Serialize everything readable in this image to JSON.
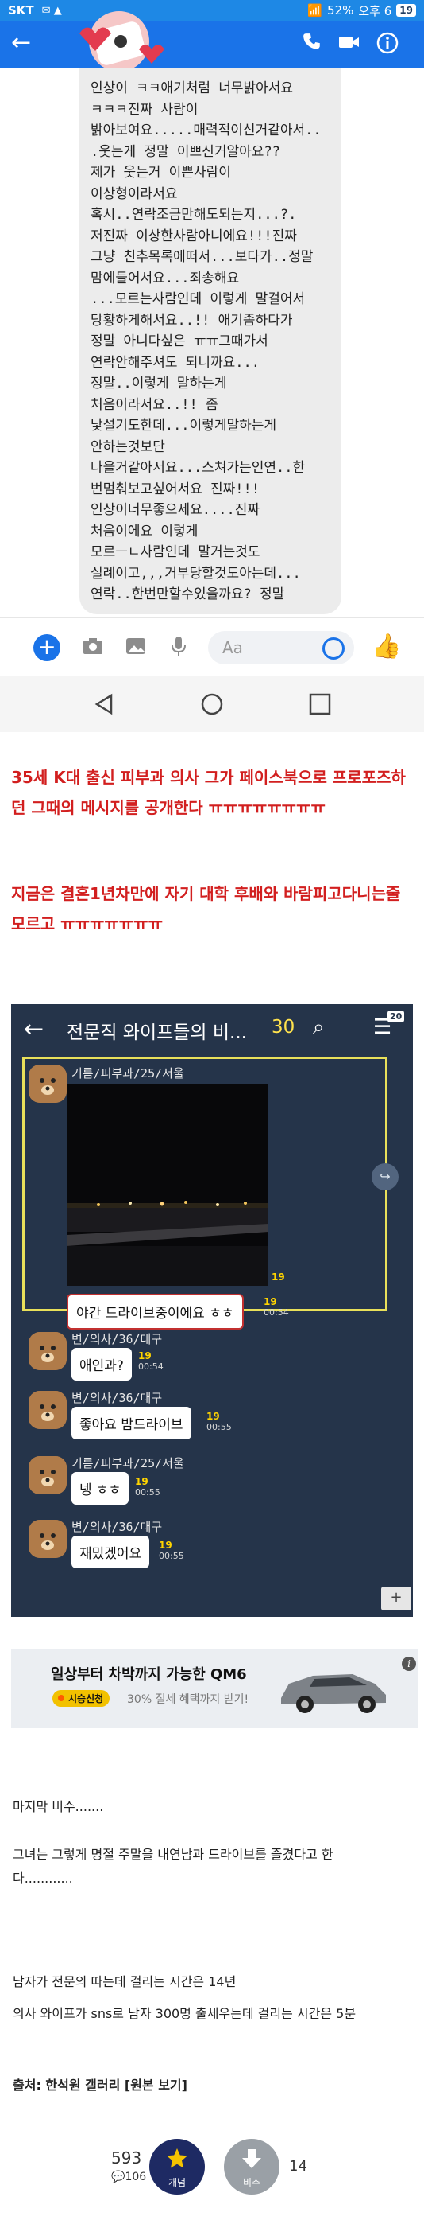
{
  "messenger": {
    "status": {
      "carrier": "SKT",
      "battery": "52%",
      "time": "오후 6",
      "badge": "19"
    },
    "chat_lines": [
      "인상이 ㅋㅋ애기처럼 너무밝아서요",
      "ㅋㅋㅋ진짜 사람이",
      "밝아보여요.....매력적이신거같아서..",
      ".웃는게 정말 이쁘신거알아요??",
      "제가 웃는거 이쁜사람이",
      "이상형이라서요",
      "혹시..연락조금만해도되는지...?.",
      "저진짜 이상한사람아니에요!!!진짜",
      "그냥 친추목록에떠서...보다가..정말",
      "맘에들어서요...죄송해요",
      "...모르는사람인데 이렇게 말걸어서",
      "당황하게해서요..!! 애기좀하다가",
      "정말 아니다싶은 ㅠㅠ그때가서",
      "연락안해주셔도 되니까요...",
      "정말..이렇게 말하는게",
      "처음이라서요..!! 좀",
      "낯설기도한데...이렇게말하는게",
      "안하는것보단",
      "나을거같아서요...스쳐가는인연..한",
      "번멈춰보고싶어서요 진짜!!!",
      "인상이너무좋으세요....진짜",
      "처음이에요 이렇게",
      "모르ㅡㄴ사람인데 말거는것도",
      "실례이고,,,거부당할것도아는데...",
      "연락..한번만할수있을까요? 정말"
    ],
    "composer": {
      "placeholder": "Aa"
    }
  },
  "article": {
    "headline_1": "35세 K대 출신 피부과 의사 그가 페이스북으로 프로포즈하던 그때의 메시지를 공개한다 ㅠㅠㅠㅠㅠㅠㅠㅠ",
    "headline_2": "지금은 결혼1년차만에 자기 대학 후배와 바람피고다니는줄 모르고 ㅠㅠㅠㅠㅠㅠㅠ",
    "para_1": "마지막 비수.......",
    "para_2_line_1": "그녀는 그렇게 명절 주말을 내연남과 드라이브를 즐겼다고 한",
    "para_2_line_2": "다............",
    "para_3_line_1": "남자가 전문의 따는데 걸리는 시간은 14년",
    "para_3_line_2": "의사 와이프가 sns로 남자 300명 출세우는데 걸리는 시간은 5분",
    "source_label": "출처: 한석원 갤러리",
    "source_link": "[원본 보기]"
  },
  "kakao": {
    "room_title": "전문직 와이프들의 비...",
    "member_count": "30",
    "menu_badge": "20",
    "messages": [
      {
        "name": "기름/피부과/25/서울",
        "text": "야간 드라이브중이에요 ㅎㅎ",
        "unread": "19",
        "time": "00:54"
      },
      {
        "name": "변/의사/36/대구",
        "text": "애인과?",
        "unread": "19",
        "time": "00:54"
      },
      {
        "name": "변/의사/36/대구",
        "text": "좋아요 밤드라이브",
        "unread": "19",
        "time": "00:55"
      },
      {
        "name": "기름/피부과/25/서울",
        "text": "넹 ㅎㅎ",
        "unread": "19",
        "time": "00:55"
      },
      {
        "name": "변/의사/36/대구",
        "text": "재밌겠어요",
        "unread": "19",
        "time": "00:55"
      }
    ],
    "photo_unread": "19"
  },
  "ad": {
    "title": "일상부터 차박까지 가능한 QM6",
    "pill": "시승신청",
    "sub": "30% 절세 혜택까지 받기!"
  },
  "votes": {
    "up_count": "593",
    "comment_count": "106",
    "up_label": "개념",
    "down_label": "비추",
    "down_count": "14"
  },
  "colors": {
    "messenger_blue": "#1a73e8",
    "headline_red": "#d21f1f",
    "kakao_bg": "#25344a",
    "highlight_yellow": "#e9e05a"
  }
}
